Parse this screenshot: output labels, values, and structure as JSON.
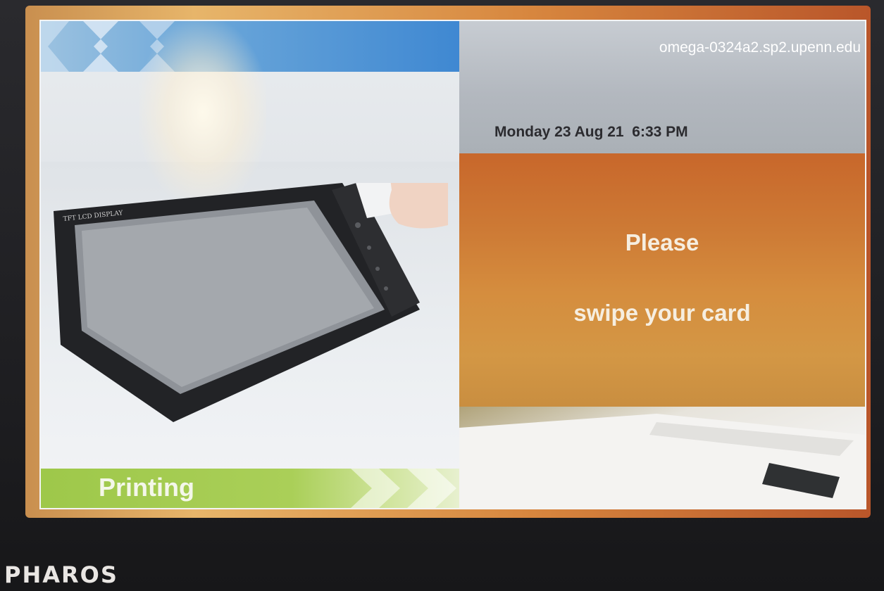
{
  "kiosk": {
    "hostname": "omega-0324a2.sp2.upenn.edu",
    "datetime": "Monday 23 Aug 21  6:33 PM",
    "prompt_line1": "Please",
    "prompt_line2": "swipe your card",
    "section_label": "Printing",
    "photo_device_label": "TFT LCD DISPLAY"
  },
  "device_brand": "PHAROS",
  "colors": {
    "accent_orange": "#cd7a35",
    "banner_green": "#9ec84a",
    "banner_blue": "#3f88d2"
  }
}
